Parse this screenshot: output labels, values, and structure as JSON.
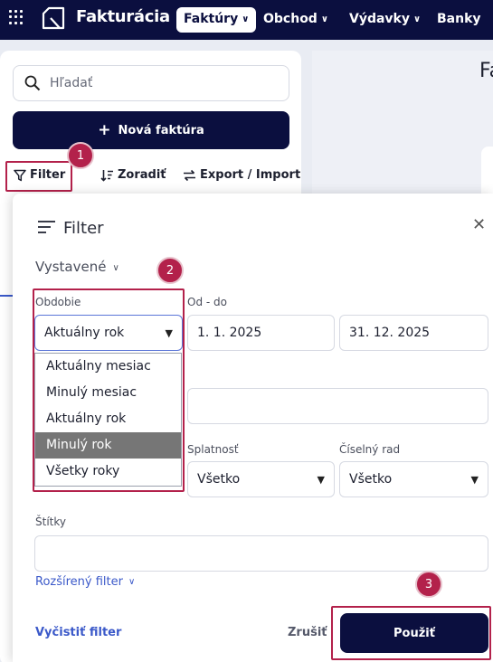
{
  "app": {
    "title": "Fakturácia"
  },
  "nav": {
    "invoices": "Faktúry",
    "commerce": "Obchod",
    "expenses": "Výdavky",
    "banks": "Banky"
  },
  "sidebar": {
    "search_placeholder": "Hľadať",
    "new_invoice": "Nová faktúra",
    "filter": "Filter",
    "sort": "Zoradiť",
    "export_import": "Export / Import"
  },
  "main": {
    "heading_partial": "Fa"
  },
  "filter_panel": {
    "title": "Filter",
    "scope": "Vystavené",
    "period_label": "Obdobie",
    "period_value": "Aktuálny rok",
    "period_options": [
      "Aktuálny mesiac",
      "Minulý mesiac",
      "Aktuálny rok",
      "Minulý rok",
      "Všetky roky"
    ],
    "period_hovered": "Minulý rok",
    "range_label": "Od - do",
    "date_from": "1. 1. 2025",
    "date_to": "31. 12. 2025",
    "due_label": "Splatnosť",
    "due_value": "Všetko",
    "numbering_label": "Číselný rad",
    "numbering_value": "Všetko",
    "tags_label": "Štítky",
    "advanced": "Rozšírený filter",
    "clear": "Vyčistiť filter",
    "cancel": "Zrušiť",
    "apply": "Použiť"
  },
  "annotations": [
    "1",
    "2",
    "3"
  ],
  "colors": {
    "navy": "#0b0f3f",
    "annotation": "#b3214b",
    "link": "#3b59c9"
  }
}
